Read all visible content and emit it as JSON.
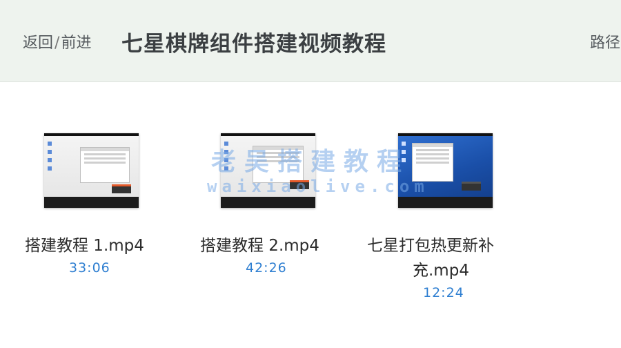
{
  "header": {
    "back_label": "返回",
    "separator": "/",
    "forward_label": "前进",
    "title": "七星棋牌组件搭建视频教程",
    "path_label": "路径"
  },
  "files": [
    {
      "name": "搭建教程 1.mp4",
      "duration": "33:06",
      "thumbnail": "desktop-light"
    },
    {
      "name": "搭建教程 2.mp4",
      "duration": "42:26",
      "thumbnail": "desktop-light"
    },
    {
      "name_line1": "七星打包热更新补",
      "name_line2": "充.mp4",
      "duration": "12:24",
      "thumbnail": "desktop-blue"
    }
  ],
  "watermark": {
    "line1": "老吴搭建教程",
    "line2": "waixiaolive.com"
  },
  "colors": {
    "header_bg": "#eef3ee",
    "duration": "#2f7fd1",
    "title": "#3b3f42"
  }
}
